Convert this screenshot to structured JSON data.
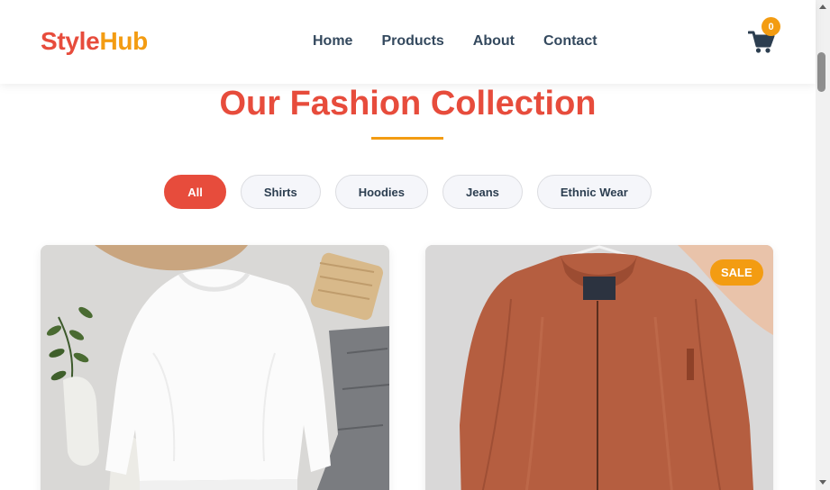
{
  "header": {
    "logo_part1": "Style",
    "logo_part2": "Hub",
    "nav": [
      "Home",
      "Products",
      "About",
      "Contact"
    ],
    "cart_icon": "shopping-cart-icon",
    "cart_count": "0"
  },
  "main": {
    "title": "Our Fashion Collection",
    "filters": [
      "All",
      "Shirts",
      "Hoodies",
      "Jeans",
      "Ethnic Wear"
    ],
    "active_filter": "All",
    "products": [
      {
        "image": "white sweatshirt flat lay",
        "badge": ""
      },
      {
        "image": "brown bomber jacket on hanger",
        "badge": "SALE"
      }
    ]
  },
  "colors": {
    "primary": "#e74c3c",
    "accent": "#f39c12",
    "text": "#34495e"
  }
}
